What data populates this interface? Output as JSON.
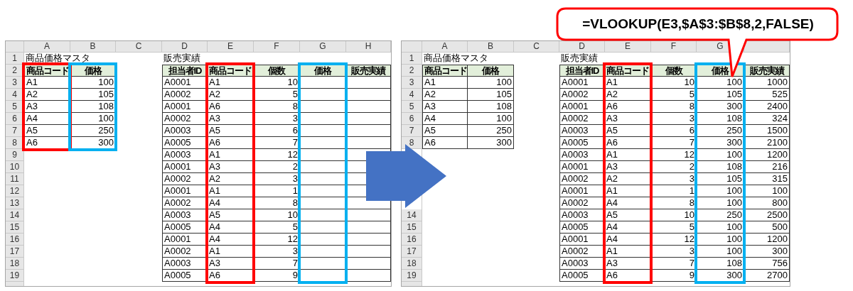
{
  "sheets": [
    {
      "column_headers": [
        "A",
        "B",
        "C",
        "D",
        "E",
        "F",
        "G",
        "H"
      ],
      "row_numbers": [
        "1",
        "2",
        "3",
        "4",
        "5",
        "6",
        "7",
        "8",
        "9",
        "10",
        "11",
        "12",
        "13",
        "14",
        "15",
        "16",
        "17",
        "18",
        "19"
      ],
      "master_title": "商品価格マスタ",
      "master_table": {
        "columns": [
          {
            "label": "商品コード",
            "color": "#ff0000"
          },
          {
            "label": "価格",
            "color": "#00b0f0"
          }
        ],
        "rows": [
          [
            "A1",
            "100"
          ],
          [
            "A2",
            "105"
          ],
          [
            "A3",
            "108"
          ],
          [
            "A4",
            "100"
          ],
          [
            "A5",
            "250"
          ],
          [
            "A6",
            "300"
          ]
        ]
      },
      "sales_title": "販売実績",
      "sales_table": {
        "columns": [
          {
            "label": "担当者ID"
          },
          {
            "label": "商品コード",
            "color": "#ff0000"
          },
          {
            "label": "個数"
          },
          {
            "label": "価格",
            "color": "#00b0f0"
          },
          {
            "label": "販売実績"
          }
        ],
        "rows": [
          [
            "A0001",
            "A1",
            "10"
          ],
          [
            "A0002",
            "A2",
            "5"
          ],
          [
            "A0001",
            "A6",
            "8"
          ],
          [
            "A0002",
            "A3",
            "3"
          ],
          [
            "A0003",
            "A5",
            "6"
          ],
          [
            "A0005",
            "A6",
            "7"
          ],
          [
            "A0003",
            "A1",
            "12"
          ],
          [
            "A0001",
            "A3",
            "2"
          ],
          [
            "A0002",
            "A2",
            "3"
          ],
          [
            "A0001",
            "A1",
            "1"
          ],
          [
            "A0002",
            "A4",
            "8"
          ],
          [
            "A0003",
            "A5",
            "10"
          ],
          [
            "A0005",
            "A4",
            "5"
          ],
          [
            "A0001",
            "A4",
            "12"
          ],
          [
            "A0002",
            "A1",
            "3"
          ],
          [
            "A0003",
            "A3",
            "7"
          ],
          [
            "A0005",
            "A6",
            "9"
          ]
        ]
      }
    },
    {
      "column_headers": [
        "A",
        "B",
        "C",
        "D",
        "E",
        "F",
        "G"
      ],
      "row_numbers": [
        "1",
        "2",
        "3",
        "4",
        "5",
        "6",
        "7",
        "8"
      ],
      "row_numbers_below_arrow": [
        "14",
        "15",
        "16",
        "17",
        "18",
        "19"
      ],
      "master_title": "商品価格マスタ",
      "master_table": {
        "columns": [
          {
            "label": "商品コード"
          },
          {
            "label": "価格"
          }
        ],
        "rows": [
          [
            "A1",
            "100"
          ],
          [
            "A2",
            "105"
          ],
          [
            "A3",
            "108"
          ],
          [
            "A4",
            "100"
          ],
          [
            "A5",
            "250"
          ],
          [
            "A6",
            "300"
          ]
        ]
      },
      "sales_title": "販売実績",
      "sales_table": {
        "columns": [
          {
            "label": "担当者ID"
          },
          {
            "label": "商品コード",
            "color": "#ff0000"
          },
          {
            "label": "個数"
          },
          {
            "label": "価格",
            "color": "#00b0f0"
          },
          {
            "label": "販売実績"
          }
        ],
        "rows": [
          [
            "A0001",
            "A1",
            "10",
            "100",
            "1000"
          ],
          [
            "A0002",
            "A2",
            "5",
            "105",
            "525"
          ],
          [
            "A0001",
            "A6",
            "8",
            "300",
            "2400"
          ],
          [
            "A0002",
            "A3",
            "3",
            "108",
            "324"
          ],
          [
            "A0003",
            "A5",
            "6",
            "250",
            "1500"
          ],
          [
            "A0005",
            "A6",
            "7",
            "300",
            "2100"
          ],
          [
            "A0003",
            "A1",
            "12",
            "100",
            "1200"
          ],
          [
            "A0001",
            "A3",
            "2",
            "108",
            "216"
          ],
          [
            "A0002",
            "A2",
            "3",
            "105",
            "315"
          ],
          [
            "A0001",
            "A1",
            "1",
            "100",
            "100"
          ],
          [
            "A0002",
            "A4",
            "8",
            "100",
            "800"
          ],
          [
            "A0003",
            "A5",
            "10",
            "250",
            "2500"
          ],
          [
            "A0005",
            "A4",
            "5",
            "100",
            "500"
          ],
          [
            "A0001",
            "A4",
            "12",
            "100",
            "1200"
          ],
          [
            "A0002",
            "A1",
            "3",
            "100",
            "300"
          ],
          [
            "A0003",
            "A3",
            "7",
            "108",
            "756"
          ],
          [
            "A0005",
            "A6",
            "9",
            "300",
            "2700"
          ]
        ]
      }
    }
  ],
  "callout": {
    "text": "=VLOOKUP(E3,$A$3:$B$8,2,FALSE)"
  }
}
